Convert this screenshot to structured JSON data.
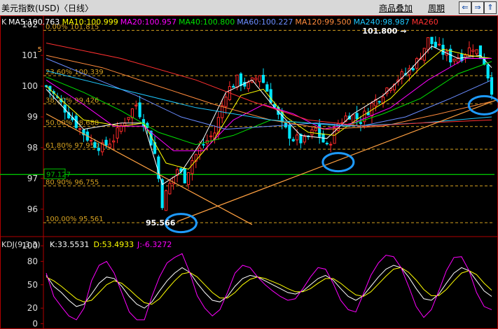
{
  "window": {
    "title": "美元指数(USD)〈日线〉",
    "overlay_button": "商品叠加",
    "period_button": "周期",
    "nav_icons": [
      "left-arrow-icon",
      "right-arrow-icon",
      "up-arrow-icon"
    ]
  },
  "colors": {
    "background": "#000000",
    "axis": "#b00000",
    "up": "#ff2a2a",
    "down": "#00e6ff",
    "fib": "#d4a020",
    "trend": "#ffa040",
    "support": "#00c000",
    "circle": "#1e9bff",
    "ma5": "#ffffff",
    "ma10": "#ffff00",
    "ma20": "#ff00ff",
    "ma40": "#00e000",
    "ma60": "#6a8cff",
    "ma120": "#ff8a3c",
    "ma240": "#1ec8ff",
    "ma260": "#ff3030",
    "kdj_k": "#ffffff",
    "kdj_d": "#ffff00",
    "kdj_j": "#ff00ff"
  },
  "ma_legend": [
    {
      "key": "ma5",
      "text": "MA5:100.763"
    },
    {
      "key": "ma10",
      "text": "MA10:100.999"
    },
    {
      "key": "ma20",
      "text": "MA20:100.957"
    },
    {
      "key": "ma40",
      "text": "MA40:100.800"
    },
    {
      "key": "ma60",
      "text": "MA60:100.227"
    },
    {
      "key": "ma120",
      "text": "MA120:99.500"
    },
    {
      "key": "ma240",
      "text": "MA240:98.987"
    },
    {
      "key": "ma260",
      "text": "MA260"
    }
  ],
  "legend_prefix": "K",
  "kdj_legend": {
    "name": "KDJ(9,3,3)",
    "k": "K:33.5531",
    "d": "D:53.4933",
    "j": "J:-6.3272"
  },
  "chart_data": [
    {
      "type": "candlestick",
      "ylim": [
        95.2,
        102.3
      ],
      "yticks": [
        96,
        97,
        98,
        99,
        100,
        101,
        102
      ],
      "fibonacci": [
        {
          "label": "0.00% 101.815",
          "value": 101.815
        },
        {
          "label": "23.60% 100.339",
          "value": 100.339
        },
        {
          "label": "38.20% 99.426",
          "value": 99.426
        },
        {
          "label": "50.00% 98.688",
          "value": 98.688
        },
        {
          "label": "61.80% 97.950",
          "value": 97.95
        },
        {
          "label": "80.90% 96.755",
          "value": 96.755
        },
        {
          "label": "100.00% 95.561",
          "value": 95.561
        }
      ],
      "support_level": {
        "label": "97.127",
        "value": 97.127
      },
      "annotations": [
        {
          "text": "101.800",
          "value": 101.8
        },
        {
          "text": "95.566",
          "value": 95.566
        }
      ],
      "left_marker": "5",
      "close_points": [
        [
          0,
          100.0
        ],
        [
          3,
          99.6
        ],
        [
          6,
          99.1
        ],
        [
          9,
          98.6
        ],
        [
          12,
          98.2
        ],
        [
          15,
          98.0
        ],
        [
          18,
          98.3
        ],
        [
          21,
          98.9
        ],
        [
          24,
          99.4
        ],
        [
          27,
          98.6
        ],
        [
          29,
          97.8
        ],
        [
          31,
          96.2
        ],
        [
          33,
          96.8
        ],
        [
          35,
          97.3
        ],
        [
          37,
          97.0
        ],
        [
          39,
          97.6
        ],
        [
          42,
          98.1
        ],
        [
          45,
          98.5
        ],
        [
          48,
          99.8
        ],
        [
          51,
          100.2
        ],
        [
          54,
          100.0
        ],
        [
          57,
          100.4
        ],
        [
          60,
          99.6
        ],
        [
          63,
          98.7
        ],
        [
          66,
          98.3
        ],
        [
          69,
          98.2
        ],
        [
          72,
          98.6
        ],
        [
          75,
          98.0
        ],
        [
          78,
          98.8
        ],
        [
          81,
          99.1
        ],
        [
          84,
          98.9
        ],
        [
          87,
          99.4
        ],
        [
          90,
          99.8
        ],
        [
          93,
          100.2
        ],
        [
          96,
          100.4
        ],
        [
          99,
          100.8
        ],
        [
          102,
          101.5
        ],
        [
          105,
          101.2
        ],
        [
          108,
          100.9
        ],
        [
          111,
          101.0
        ],
        [
          114,
          101.3
        ],
        [
          117,
          100.8
        ],
        [
          119,
          99.9
        ]
      ],
      "ma_points": {
        "ma5": [
          [
            0,
            99.9
          ],
          [
            10,
            98.6
          ],
          [
            20,
            98.8
          ],
          [
            26,
            98.8
          ],
          [
            31,
            96.8
          ],
          [
            36,
            97.2
          ],
          [
            42,
            98.3
          ],
          [
            48,
            99.8
          ],
          [
            55,
            100.2
          ],
          [
            61,
            99.3
          ],
          [
            68,
            98.4
          ],
          [
            75,
            98.3
          ],
          [
            82,
            99.1
          ],
          [
            90,
            99.7
          ],
          [
            97,
            100.5
          ],
          [
            103,
            101.3
          ],
          [
            110,
            100.9
          ],
          [
            116,
            101.0
          ],
          [
            119,
            100.6
          ]
        ],
        "ma10": [
          [
            0,
            100.0
          ],
          [
            10,
            98.9
          ],
          [
            20,
            98.7
          ],
          [
            26,
            98.8
          ],
          [
            32,
            97.5
          ],
          [
            38,
            97.3
          ],
          [
            45,
            98.3
          ],
          [
            52,
            99.7
          ],
          [
            58,
            99.9
          ],
          [
            64,
            99.0
          ],
          [
            70,
            98.5
          ],
          [
            77,
            98.4
          ],
          [
            84,
            99.0
          ],
          [
            92,
            99.6
          ],
          [
            100,
            100.6
          ],
          [
            106,
            101.2
          ],
          [
            113,
            101.0
          ],
          [
            119,
            100.9
          ]
        ],
        "ma20": [
          [
            0,
            100.2
          ],
          [
            10,
            99.4
          ],
          [
            18,
            98.7
          ],
          [
            26,
            98.7
          ],
          [
            34,
            97.9
          ],
          [
            42,
            97.9
          ],
          [
            50,
            98.9
          ],
          [
            58,
            99.4
          ],
          [
            66,
            99.1
          ],
          [
            74,
            98.6
          ],
          [
            82,
            98.8
          ],
          [
            92,
            99.3
          ],
          [
            102,
            100.2
          ],
          [
            112,
            100.9
          ],
          [
            119,
            100.9
          ]
        ],
        "ma40": [
          [
            0,
            100.3
          ],
          [
            10,
            99.8
          ],
          [
            20,
            99.2
          ],
          [
            30,
            98.5
          ],
          [
            40,
            98.1
          ],
          [
            50,
            98.4
          ],
          [
            60,
            98.9
          ],
          [
            70,
            98.8
          ],
          [
            80,
            98.7
          ],
          [
            90,
            99.1
          ],
          [
            100,
            99.6
          ],
          [
            110,
            100.4
          ],
          [
            119,
            100.8
          ]
        ],
        "ma60": [
          [
            0,
            100.9
          ],
          [
            12,
            100.3
          ],
          [
            24,
            99.7
          ],
          [
            36,
            99.0
          ],
          [
            48,
            98.6
          ],
          [
            60,
            98.7
          ],
          [
            72,
            98.8
          ],
          [
            84,
            98.7
          ],
          [
            96,
            99.0
          ],
          [
            108,
            99.6
          ],
          [
            119,
            100.2
          ]
        ],
        "ma120": [
          [
            0,
            101.0
          ],
          [
            15,
            100.6
          ],
          [
            30,
            100.0
          ],
          [
            45,
            99.4
          ],
          [
            60,
            98.9
          ],
          [
            75,
            98.6
          ],
          [
            90,
            98.7
          ],
          [
            105,
            99.1
          ],
          [
            119,
            99.5
          ]
        ],
        "ma240": [
          [
            0,
            100.5
          ],
          [
            20,
            99.9
          ],
          [
            40,
            99.3
          ],
          [
            60,
            98.9
          ],
          [
            80,
            98.7
          ],
          [
            100,
            98.8
          ],
          [
            119,
            99.0
          ]
        ],
        "ma260": [
          [
            0,
            101.4
          ],
          [
            20,
            100.9
          ],
          [
            40,
            100.2
          ],
          [
            55,
            99.5
          ],
          [
            70,
            98.9
          ],
          [
            85,
            98.7
          ],
          [
            100,
            98.8
          ],
          [
            119,
            98.9
          ]
        ]
      },
      "trendlines": [
        {
          "from": [
            0,
            99.1
          ],
          "to": [
            55,
            95.5
          ]
        },
        {
          "from": [
            35,
            95.6
          ],
          "to": [
            130,
            100.0
          ]
        }
      ],
      "circles": [
        [
          36,
          95.55
        ],
        [
          78,
          97.53
        ],
        [
          117,
          99.38
        ]
      ]
    },
    {
      "type": "line",
      "name": "KDJ",
      "ylim": [
        -5,
        110
      ],
      "yticks": [
        0,
        20,
        50,
        80,
        100
      ],
      "series": [
        {
          "name": "K",
          "values": [
            62,
            48,
            40,
            30,
            22,
            25,
            38,
            52,
            60,
            58,
            48,
            35,
            25,
            20,
            28,
            42,
            55,
            65,
            72,
            66,
            52,
            40,
            30,
            28,
            35,
            48,
            58,
            62,
            60,
            55,
            50,
            45,
            40,
            38,
            42,
            50,
            58,
            62,
            56,
            45,
            35,
            30,
            36,
            48,
            60,
            70,
            75,
            72,
            60,
            45,
            32,
            30,
            38,
            52,
            65,
            72,
            68,
            55,
            42,
            35
          ]
        },
        {
          "name": "D",
          "values": [
            60,
            55,
            48,
            40,
            32,
            28,
            30,
            40,
            50,
            55,
            52,
            44,
            35,
            27,
            25,
            32,
            44,
            55,
            64,
            66,
            60,
            50,
            40,
            33,
            33,
            40,
            50,
            57,
            60,
            58,
            54,
            50,
            45,
            41,
            41,
            45,
            52,
            58,
            58,
            52,
            44,
            37,
            35,
            41,
            51,
            61,
            70,
            72,
            66,
            56,
            44,
            36,
            36,
            44,
            55,
            65,
            68,
            63,
            52,
            43
          ]
        },
        {
          "name": "J",
          "values": [
            65,
            35,
            22,
            10,
            5,
            20,
            55,
            75,
            80,
            65,
            40,
            15,
            5,
            5,
            35,
            60,
            78,
            85,
            90,
            66,
            36,
            20,
            10,
            18,
            40,
            65,
            75,
            72,
            60,
            50,
            42,
            35,
            30,
            32,
            45,
            60,
            72,
            70,
            52,
            30,
            18,
            15,
            38,
            62,
            78,
            88,
            86,
            72,
            48,
            22,
            8,
            18,
            42,
            68,
            85,
            86,
            68,
            40,
            22,
            18
          ]
        }
      ]
    }
  ]
}
